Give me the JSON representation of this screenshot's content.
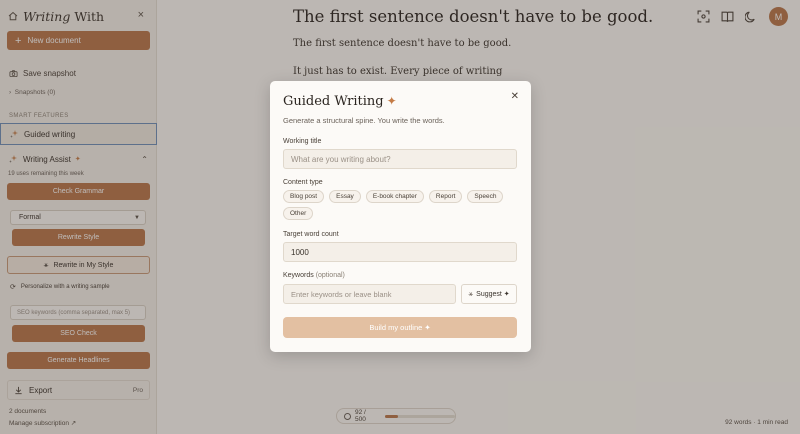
{
  "sidebar": {
    "brand_italic": "Writing",
    "brand_rest": " With",
    "close_icon": "×",
    "new_document": "New document",
    "save_snapshot": "Save snapshot",
    "snapshots": "Snapshots (0)",
    "smart_features_label": "SMART FEATURES",
    "guided_writing": "Guided writing",
    "writing_assist": "Writing Assist",
    "uses_remaining": "19 uses remaining this week",
    "check_grammar": "Check Grammar",
    "style_selected": "Formal",
    "rewrite_style": "Rewrite Style",
    "rewrite_my_style": "Rewrite in My Style",
    "personalize": "Personalize with a writing sample",
    "seo_placeholder": "SEO keywords (comma separated, max 5)",
    "seo_check": "SEO Check",
    "generate_headlines": "Generate Headlines",
    "export": "Export",
    "export_badge": "Pro",
    "doc_count": "2 documents",
    "manage_subscription": "Manage subscription ↗"
  },
  "editor": {
    "title": "The first sentence doesn't have to be good.",
    "paragraphs": [
      "The first sentence doesn't have to be good.",
      "It just has to exist. Every piece of writing"
    ],
    "avatar_initial": "M",
    "counter_text": "92 / 500",
    "counter_progress": 0.184,
    "word_info": "92 words · 1 min read"
  },
  "modal": {
    "title": "Guided Writing",
    "subtitle": "Generate a structural spine. You write the words.",
    "working_title_label": "Working title",
    "working_title_placeholder": "What are you writing about?",
    "content_type_label": "Content type",
    "content_types": [
      "Blog post",
      "Essay",
      "E-book chapter",
      "Report",
      "Speech",
      "Other"
    ],
    "target_label": "Target word count",
    "target_value": "1000",
    "keywords_label": "Keywords",
    "keywords_optional": "(optional)",
    "keywords_placeholder": "Enter keywords or leave blank",
    "suggest": "Suggest ✦",
    "build": "Build my outline ✦"
  },
  "colors": {
    "accent": "#b8774a",
    "accent_light": "#e3c0a2",
    "background": "#fbf8f3",
    "sidebar": "#f4efe7"
  },
  "icons": {
    "home": "home-icon",
    "camera": "camera-icon",
    "sparkles": "sparkles-icon",
    "focus": "focus-icon",
    "book": "book-icon",
    "moon": "moon-icon",
    "download": "download-icon"
  }
}
